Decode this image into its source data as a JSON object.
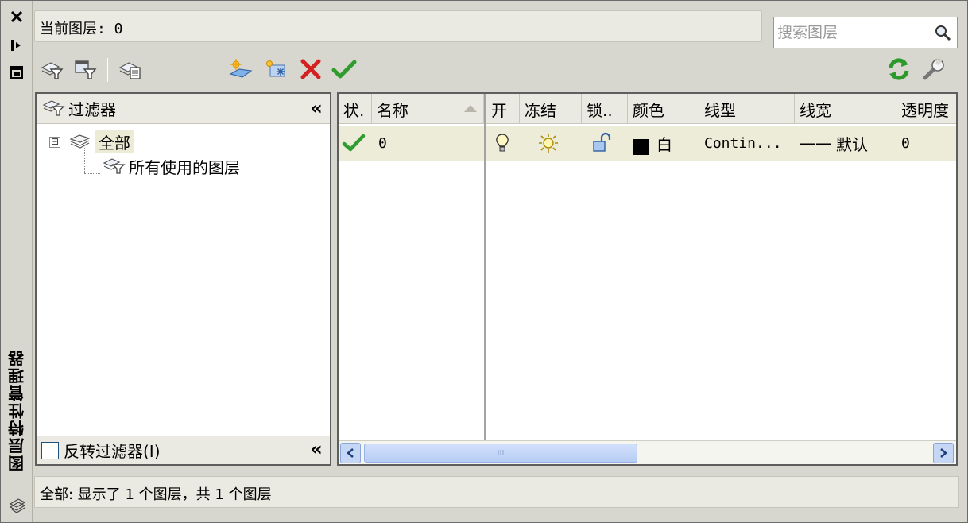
{
  "palette": {
    "title": "图层特性管理器",
    "close_icon": "close-icon",
    "autohide_icon": "auto-hide-icon",
    "properties_icon": "properties-icon",
    "layers_icon": "layers-stack-icon"
  },
  "header": {
    "current_layer": "当前图层: 0",
    "search_placeholder": "搜索图层"
  },
  "toolbar": {
    "left": [
      "new-property-filter-icon",
      "new-group-filter-icon",
      "layer-states-manager-icon"
    ],
    "middle": [
      "new-layer-icon",
      "new-layer-vp-frozen-icon",
      "delete-layer-icon",
      "set-current-icon"
    ],
    "right": [
      "refresh-icon",
      "settings-wrench-icon"
    ]
  },
  "filters": {
    "header": "过滤器",
    "tree": [
      {
        "label": "全部",
        "expander": "⊟",
        "selected": true
      },
      {
        "label": "所有使用的图层",
        "selected": false
      }
    ],
    "invert_label": "反转过滤器(I)",
    "invert_checked": false
  },
  "grid": {
    "columns": [
      "状.",
      "名称",
      "开",
      "冻结",
      "锁..",
      "颜色",
      "线型",
      "线宽",
      "透明度"
    ],
    "rows": [
      {
        "status": "current",
        "name": "0",
        "on": "light-bulb-on-icon",
        "freeze": "sun-thawed-icon",
        "lock": "unlocked-padlock-icon",
        "color_swatch": "#000000",
        "color": "白",
        "linetype": "Contin...",
        "lineweight_dash": "——",
        "lineweight": "默认",
        "transparency": "0"
      }
    ],
    "scroll_grip": "III"
  },
  "status": {
    "text": "全部: 显示了 1 个图层，共 1 个图层"
  },
  "colors": {
    "panel_bg": "#d8d7cf",
    "header_bg": "#eae9e2",
    "row_highlight": "#edecd9",
    "scroll_blue": "#c6d6f5"
  }
}
